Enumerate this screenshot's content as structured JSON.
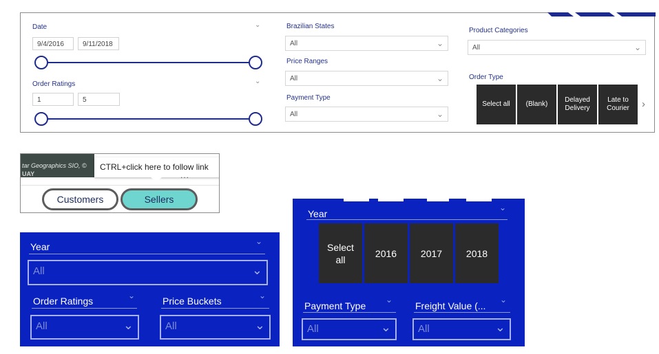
{
  "top_panel": {
    "date": {
      "label": "Date",
      "start": "9/4/2016",
      "end": "9/11/2018"
    },
    "order_ratings": {
      "label": "Order Ratings",
      "min": "1",
      "max": "5"
    },
    "brazilian_states": {
      "label": "Brazilian States",
      "value": "All"
    },
    "price_ranges": {
      "label": "Price Ranges",
      "value": "All"
    },
    "payment_type": {
      "label": "Payment Type",
      "value": "All"
    },
    "product_categories": {
      "label": "Product Categories",
      "value": "All"
    },
    "order_type": {
      "label": "Order Type",
      "tiles": [
        "Select all",
        "(Blank)",
        "Delayed\nDelivery",
        "Late to\nCourier"
      ]
    }
  },
  "map_panel": {
    "attribution": "tar Geographics SIO, ©",
    "map_text": "UAY",
    "tooltip": "CTRL+click here to follow link",
    "more": "...",
    "toggle_customers": "Customers",
    "toggle_sellers": "Sellers"
  },
  "left_blue": {
    "year": {
      "label": "Year",
      "value": "All"
    },
    "order_ratings": {
      "label": "Order Ratings",
      "value": "All"
    },
    "price_buckets": {
      "label": "Price Buckets",
      "value": "All"
    }
  },
  "right_blue": {
    "year": {
      "label": "Year",
      "tiles": [
        "Select\nall",
        "2016",
        "2017",
        "2018"
      ]
    },
    "payment_type": {
      "label": "Payment Type",
      "value": "All"
    },
    "freight_value": {
      "label": "Freight Value (...",
      "value": "All"
    }
  },
  "colors": {
    "navy": "#1d2b8f",
    "panel_blue": "#0a22bf",
    "tile_dark": "#2b2b2b",
    "sellers_teal": "#6fd6cf"
  }
}
